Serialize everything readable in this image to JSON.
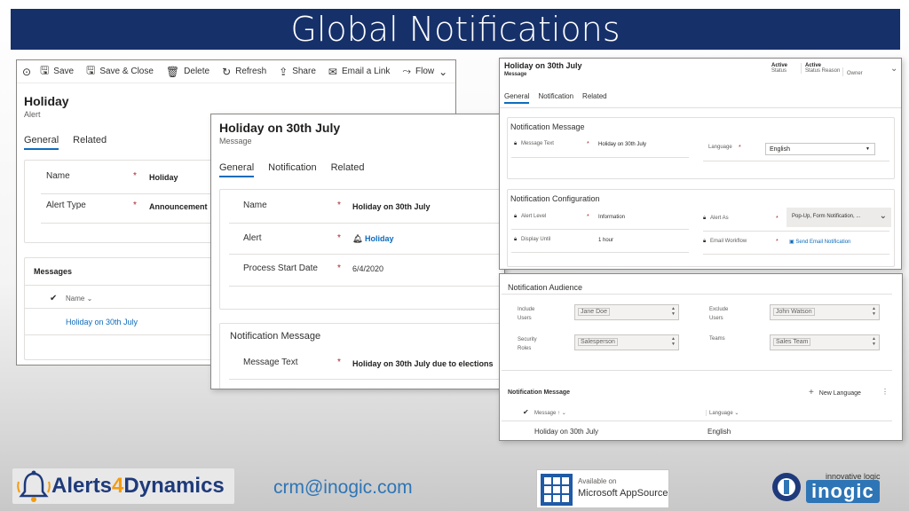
{
  "banner": {
    "title": "Global Notifications"
  },
  "alert_form": {
    "toolbar": {
      "save": "Save",
      "save_close": "Save & Close",
      "delete": "Delete",
      "refresh": "Refresh",
      "share": "Share",
      "email_link": "Email a Link",
      "flow": "Flow"
    },
    "title": "Holiday",
    "entity": "Alert",
    "tabs": [
      "General",
      "Related"
    ],
    "fields": [
      {
        "label": "Name",
        "value": "Holiday"
      },
      {
        "label": "Alert Type",
        "value": "Announcement"
      }
    ],
    "messages": {
      "heading": "Messages",
      "column": "Name",
      "rows": [
        "Holiday on 30th July"
      ]
    }
  },
  "message_form": {
    "title": "Holiday on 30th July",
    "entity": "Message",
    "tabs": [
      "General",
      "Notification",
      "Related"
    ],
    "fields": [
      {
        "label": "Name",
        "value": "Holiday on 30th July"
      },
      {
        "label": "Alert",
        "value": "Holiday"
      },
      {
        "label": "Process Start Date",
        "value": "6/4/2020"
      }
    ],
    "notification_message": {
      "heading": "Notification Message",
      "label": "Message Text",
      "value": "Holiday on 30th July due to elections"
    }
  },
  "detail_form": {
    "title": "Holiday on 30th July",
    "entity": "Message",
    "status": {
      "value": "Active",
      "label": "Status"
    },
    "status_reason": {
      "value": "Active",
      "label": "Status Reason"
    },
    "owner_label": "Owner",
    "tabs": [
      "General",
      "Notification",
      "Related"
    ],
    "notification_message": {
      "heading": "Notification Message",
      "message_label": "Message Text",
      "message_value": "Holiday on 30th July",
      "language_label": "Language",
      "language_value": "English"
    },
    "notification_config": {
      "heading": "Notification Configuration",
      "alert_level_label": "Alert Level",
      "alert_level_value": "Information",
      "alert_as_label": "Alert As",
      "alert_as_value": "Pop-Up, Form Notification, ...",
      "display_until_label": "Display Until",
      "display_until_value": "1 hour",
      "email_workflow_label": "Email Workflow",
      "email_workflow_value": "Send Email Notification"
    }
  },
  "audience_form": {
    "heading": "Notification Audience",
    "include_users_label1": "Include",
    "include_users_label2": "Users",
    "include_users_value": "Jane Doe",
    "exclude_users_label1": "Exclude",
    "exclude_users_label2": "Users",
    "exclude_users_value": "John Watson",
    "security_roles_label1": "Security",
    "security_roles_label2": "Roles",
    "security_roles_value": "Salesperson",
    "teams_label": "Teams",
    "teams_value": "Sales Team",
    "grid": {
      "heading": "Notification Message",
      "new_language": "New Language",
      "col_message": "Message",
      "col_language": "Language",
      "row_message": "Holiday on 30th July",
      "row_language": "English"
    }
  },
  "footer": {
    "brand_part1": "Alerts",
    "brand_part2": "4",
    "brand_part3": "Dynamics",
    "email": "crm@inogic.com",
    "appsource_line1": "Available on",
    "appsource_line2": "Microsoft AppSource",
    "inogic_tagline": "innovative logic",
    "inogic_name": "inogic"
  },
  "colors": {
    "banner": "#16306a",
    "accent": "#0f6cbd",
    "required": "#a4262c",
    "brand_orange": "#f39c12"
  }
}
